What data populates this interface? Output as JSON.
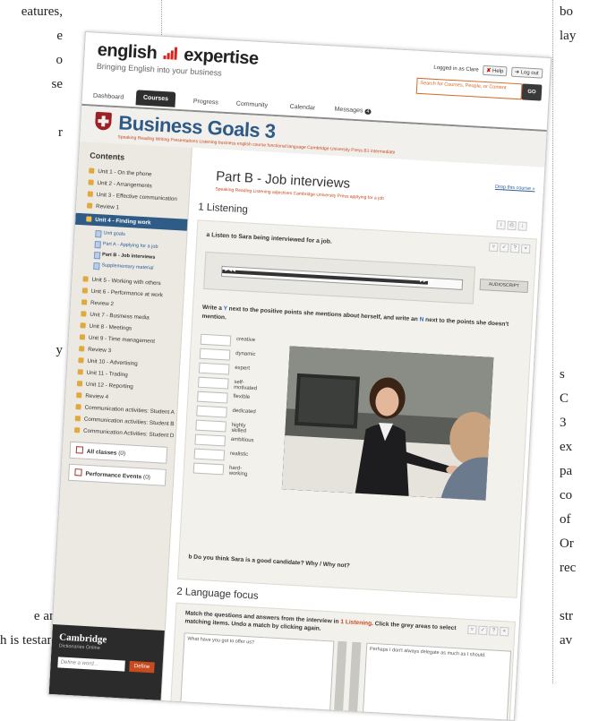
{
  "magazine": {
    "left_lines": [
      "eatures,",
      "e",
      "o",
      "se",
      "",
      "r",
      "",
      "",
      "",
      "",
      "",
      "",
      "",
      "",
      "y",
      "",
      "",
      "",
      "",
      "",
      "",
      "",
      "",
      "",
      "",
      "e and",
      "h is testament"
    ],
    "right_lines": [
      "bo",
      "lay",
      "",
      "",
      "",
      "",
      "",
      "",
      "",
      "",
      "",
      "",
      "",
      "",
      "",
      "s",
      "C",
      "3",
      "ex",
      "pa",
      "co",
      "of",
      "Or",
      "rec",
      "",
      "str",
      "av"
    ]
  },
  "header": {
    "logo_text_1": "english",
    "logo_text_2": "expertise",
    "tagline": "Bringing English into your business",
    "logged_in": "Logged in as Clare",
    "help": "Help",
    "logout": "Log out",
    "search_placeholder": "Search for Courses, People, or Content",
    "go_label": "GO"
  },
  "nav": {
    "tabs": [
      {
        "label": "Dashboard"
      },
      {
        "label": "Courses"
      },
      {
        "label": "Progress"
      },
      {
        "label": "Community"
      },
      {
        "label": "Calendar"
      },
      {
        "label": "Messages"
      }
    ],
    "messages_count": "4"
  },
  "course": {
    "title": "Business Goals 3",
    "tags": "Speaking  Reading  Writing  Presentations  Listening  business english  course  functional language  Cambridge University Press  B1 intermediate"
  },
  "sidebar": {
    "heading": "Contents",
    "units_before": [
      {
        "label": "Unit 1 - On the phone"
      },
      {
        "label": "Unit 2 - Arrangements"
      },
      {
        "label": "Unit 3 - Effective communication"
      },
      {
        "label": "Review 1"
      }
    ],
    "active_unit": "Unit 4 - Finding work",
    "subitems": [
      {
        "label": "Unit goals"
      },
      {
        "label": "Part A - Applying for a job"
      },
      {
        "label": "Part B - Job interviews"
      },
      {
        "label": "Supplementary material"
      }
    ],
    "units_after": [
      {
        "label": "Unit 5 - Working with others"
      },
      {
        "label": "Unit 6 - Performance at work"
      },
      {
        "label": "Review 2"
      },
      {
        "label": "Unit 7 - Business media"
      },
      {
        "label": "Unit 8 - Meetings"
      },
      {
        "label": "Unit 9 - Time management"
      },
      {
        "label": "Review 3"
      },
      {
        "label": "Unit 10 - Advertising"
      },
      {
        "label": "Unit 11 - Trading"
      },
      {
        "label": "Unit 12 - Reporting"
      },
      {
        "label": "Review 4"
      },
      {
        "label": "Communication activities: Student A"
      },
      {
        "label": "Communication activities: Student B"
      },
      {
        "label": "Communication Activities: Student D"
      }
    ],
    "all_classes": "All classes",
    "all_classes_count": "(0)",
    "performance_events": "Performance Events",
    "performance_events_count": "(0)",
    "cambridge_name": "Cambridge",
    "cambridge_sub": "Dictionaries Online",
    "define_placeholder": "Define a word...",
    "define_button": "Define"
  },
  "main": {
    "part_title": "Part B - Job interviews",
    "part_tags": "Speaking  Reading  Listening  adjectives  Cambridge University Press  applying for a job",
    "drop_link": "Drop this course »",
    "section1_title": "1 Listening",
    "q_a": "a   Listen to Sara being interviewed for a job.",
    "audioscript": "AUDIOSCRIPT",
    "instruction_1": "Write a ",
    "instruction_y": "Y",
    "instruction_2": " next to the positive points she mentions about herself, and write an ",
    "instruction_n": "N",
    "instruction_3": " next to the points she doesn't mention.",
    "words": [
      {
        "label": "creative"
      },
      {
        "label": "dynamic"
      },
      {
        "label": "expert"
      },
      {
        "label": "self-motivated"
      },
      {
        "label": "flexible"
      },
      {
        "label": "dedicated"
      },
      {
        "label": "highly skilled"
      },
      {
        "label": "ambitious"
      },
      {
        "label": "realistic"
      },
      {
        "label": "hard-working"
      }
    ],
    "q_b": "b   Do you think Sara is a good candidate? Why / Why not?",
    "section2_title": "2 Language focus",
    "match_1": "Match the questions and answers from the interview in ",
    "match_link": "1 Listening",
    "match_2": ". Click the grey areas to select matching items. Undo a match by clicking again.",
    "match_left": "What have you got to offer us?",
    "match_right": "Perhaps I don't always delegate as much as I should."
  },
  "colors": {
    "brand_red": "#d9231c",
    "title_blue": "#2e5a88",
    "tag_orange": "#c84a1f",
    "sidebar_active": "#2f5b87"
  }
}
